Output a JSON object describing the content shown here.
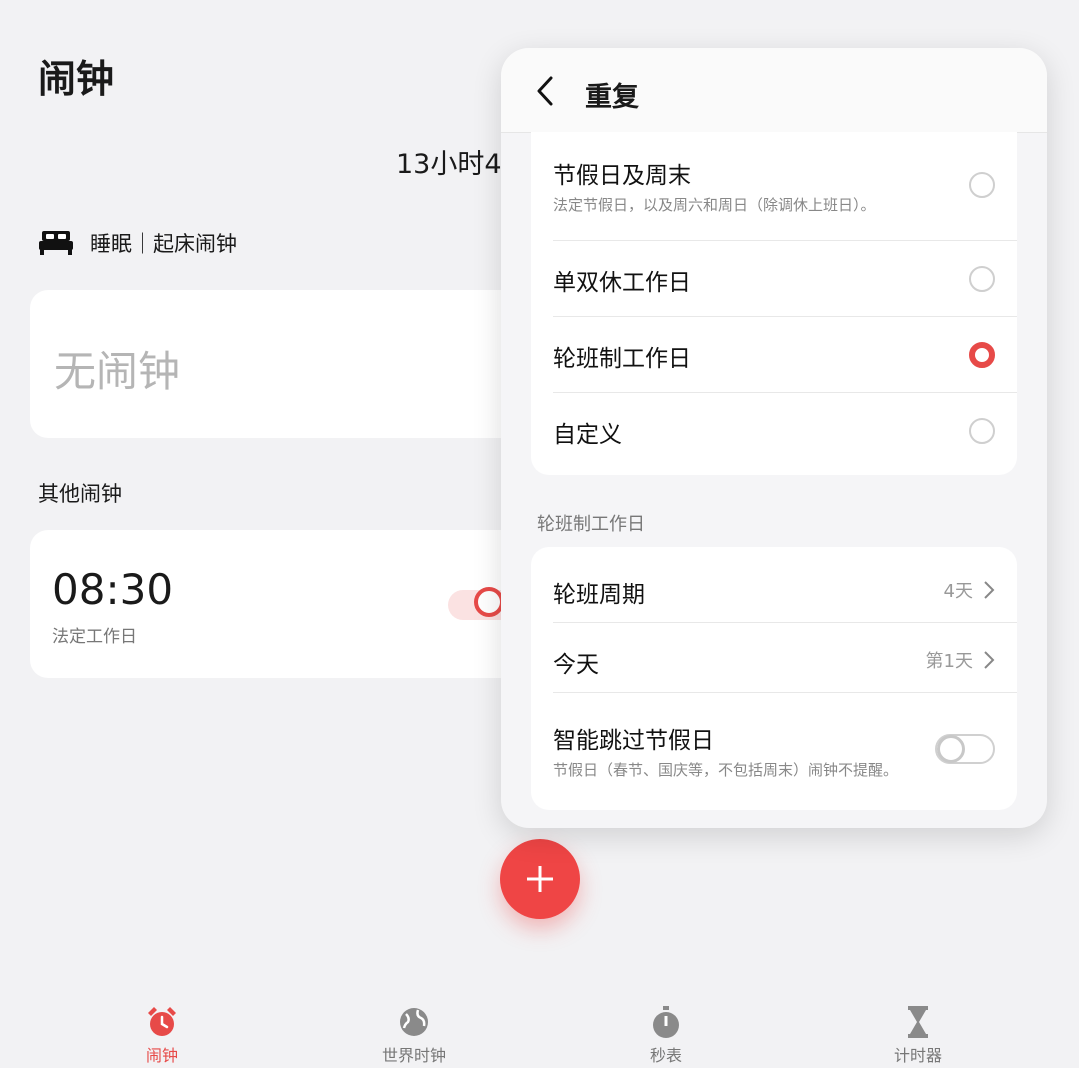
{
  "page": {
    "title": "闹钟",
    "countdown": "13小时4",
    "sleep_label": "睡眠｜起床闹钟",
    "empty_text": "无闹钟",
    "other_section": "其他闹钟"
  },
  "alarm": {
    "time": "08:30",
    "repeat": "法定工作日",
    "enabled": true
  },
  "nav": {
    "items": [
      {
        "label": "闹钟",
        "icon": "alarm-clock-icon",
        "active": true
      },
      {
        "label": "世界时钟",
        "icon": "globe-icon",
        "active": false
      },
      {
        "label": "秒表",
        "icon": "stopwatch-icon",
        "active": false
      },
      {
        "label": "计时器",
        "icon": "hourglass-icon",
        "active": false
      }
    ]
  },
  "repeat_panel": {
    "title": "重复",
    "options": [
      {
        "title": "节假日及周末",
        "subtitle": "法定节假日，以及周六和周日（除调休上班日）。",
        "selected": false
      },
      {
        "title": "单双休工作日",
        "selected": false
      },
      {
        "title": "轮班制工作日",
        "selected": true
      },
      {
        "title": "自定义",
        "selected": false
      }
    ],
    "shift_section_label": "轮班制工作日",
    "shift_cycle": {
      "title": "轮班周期",
      "value": "4天"
    },
    "today": {
      "title": "今天",
      "value": "第1天"
    },
    "skip_holidays": {
      "title": "智能跳过节假日",
      "subtitle": "节假日（春节、国庆等，不包括周末）闹钟不提醒。",
      "enabled": false
    }
  },
  "colors": {
    "accent": "#e74a48",
    "background": "#f2f2f4",
    "card": "#ffffff"
  }
}
